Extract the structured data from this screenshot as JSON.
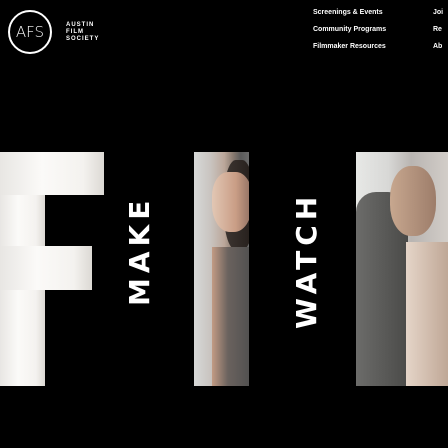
{
  "logo": {
    "mark": "AFS",
    "lines": [
      "AUSTIN",
      "FILM",
      "SOCIETY"
    ]
  },
  "nav": {
    "col1": [
      "Screenings & Events",
      "Community Programs",
      "Filmmaker Resources"
    ],
    "col2": [
      "Joi",
      "Re",
      "Ab"
    ]
  },
  "hero": {
    "words": {
      "make": "MAKE",
      "watch": "WATCH"
    },
    "backdrop_letters": "FIL"
  },
  "colors": {
    "background": "#000000",
    "text": "#ffffff"
  }
}
